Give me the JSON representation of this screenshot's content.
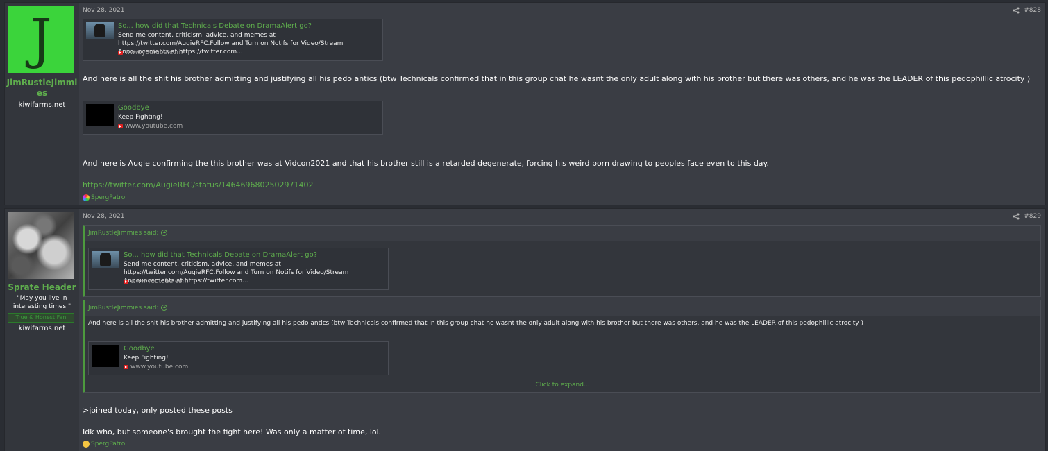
{
  "posts": [
    {
      "username": "JimRustleJimmies",
      "avatar_letter": "J",
      "site": "kiwifarms.net",
      "date": "Nov 28, 2021",
      "number": "#828",
      "embed1": {
        "title": "So... how did that Technicals Debate on DramaAlert go?",
        "desc": "Send me content, criticism, advice, and memes at https://twitter.com/AugieRFC.Follow and Turn on Notifs for Video/Stream Announcements at https://twitter.com...",
        "source": "www.youtube.com"
      },
      "text1": "And here is all the shit his brother admitting and justifying all his pedo antics (btw Technicals confirmed that in this group chat he wasnt the only adult along with his brother but there was others, and he was the LEADER of this pedophillic atrocity )",
      "embed2": {
        "title": "Goodbye",
        "desc": "Keep Fighting!",
        "source": "www.youtube.com"
      },
      "text2": "And here is Augie confirming the this brother was at Vidcon2021 and that his brother still is a retarded degenerate, forcing his weird porn drawing to peoples face even to this day.",
      "link": "https://twitter.com/AugieRFC/status/1464696802502971402",
      "reaction": "SpergPatrol"
    },
    {
      "username": "Sprate Header",
      "user_title": "\"May you live in interesting times.\"",
      "banner": "True & Honest Fan",
      "site": "kiwifarms.net",
      "date": "Nov 28, 2021",
      "number": "#829",
      "quote1": {
        "author": "JimRustleJimmies said:",
        "embed": {
          "title": "So... how did that Technicals Debate on DramaAlert go?",
          "desc": "Send me content, criticism, advice, and memes at https://twitter.com/AugieRFC.Follow and Turn on Notifs for Video/Stream Announcements at https://twitter.com...",
          "source": "www.youtube.com"
        }
      },
      "quote2": {
        "author": "JimRustleJimmies said:",
        "text": "And here is all the shit his brother admitting and justifying all his pedo antics (btw Technicals confirmed that in this group chat he wasnt the only adult along with his brother but there was others, and he was the LEADER of this pedophillic atrocity )",
        "embed": {
          "title": "Goodbye",
          "desc": "Keep Fighting!",
          "source": "www.youtube.com"
        },
        "expand": "Click to expand..."
      },
      "text1": ">joined today, only posted these posts",
      "text2": "Idk who, but someone's brought the fight here! Was only a matter of time, lol.",
      "reaction": "SpergPatrol"
    }
  ]
}
